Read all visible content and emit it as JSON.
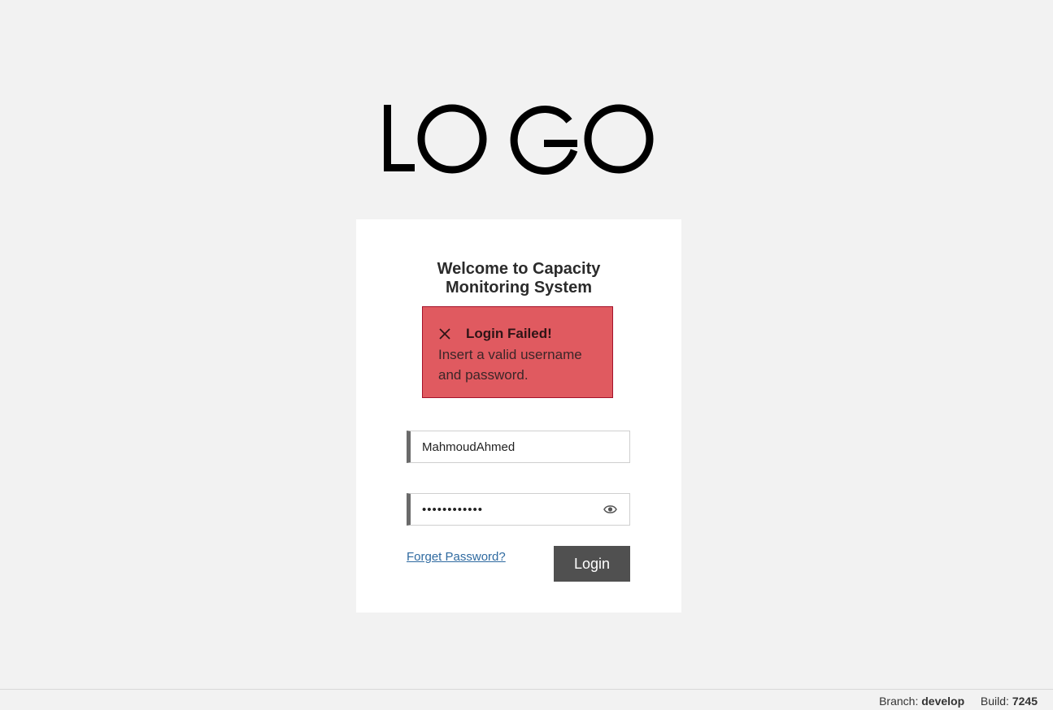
{
  "logo": {
    "text": "LOGO"
  },
  "login_card": {
    "title_line1": "Welcome to Capacity",
    "title_line2": "Monitoring System",
    "error": {
      "title": "Login Failed!",
      "message_line1": "Insert a valid username",
      "message_line2": "and password.",
      "background_color": "#e05a60",
      "border_color": "#a4122a"
    },
    "username": {
      "value": "MahmoudAhmed"
    },
    "password": {
      "value": "••••••••••••"
    },
    "forget_password_label": "Forget Password?",
    "login_button_label": "Login"
  },
  "footer": {
    "branch_label": "Branch:",
    "branch_value": "develop",
    "build_label": "Build:",
    "build_value": "7245"
  },
  "colors": {
    "page_background": "#f2f2f2",
    "button_background": "#505050",
    "link": "#2f6aa0"
  },
  "icons": {
    "close": "close-icon",
    "eye": "eye-icon"
  }
}
